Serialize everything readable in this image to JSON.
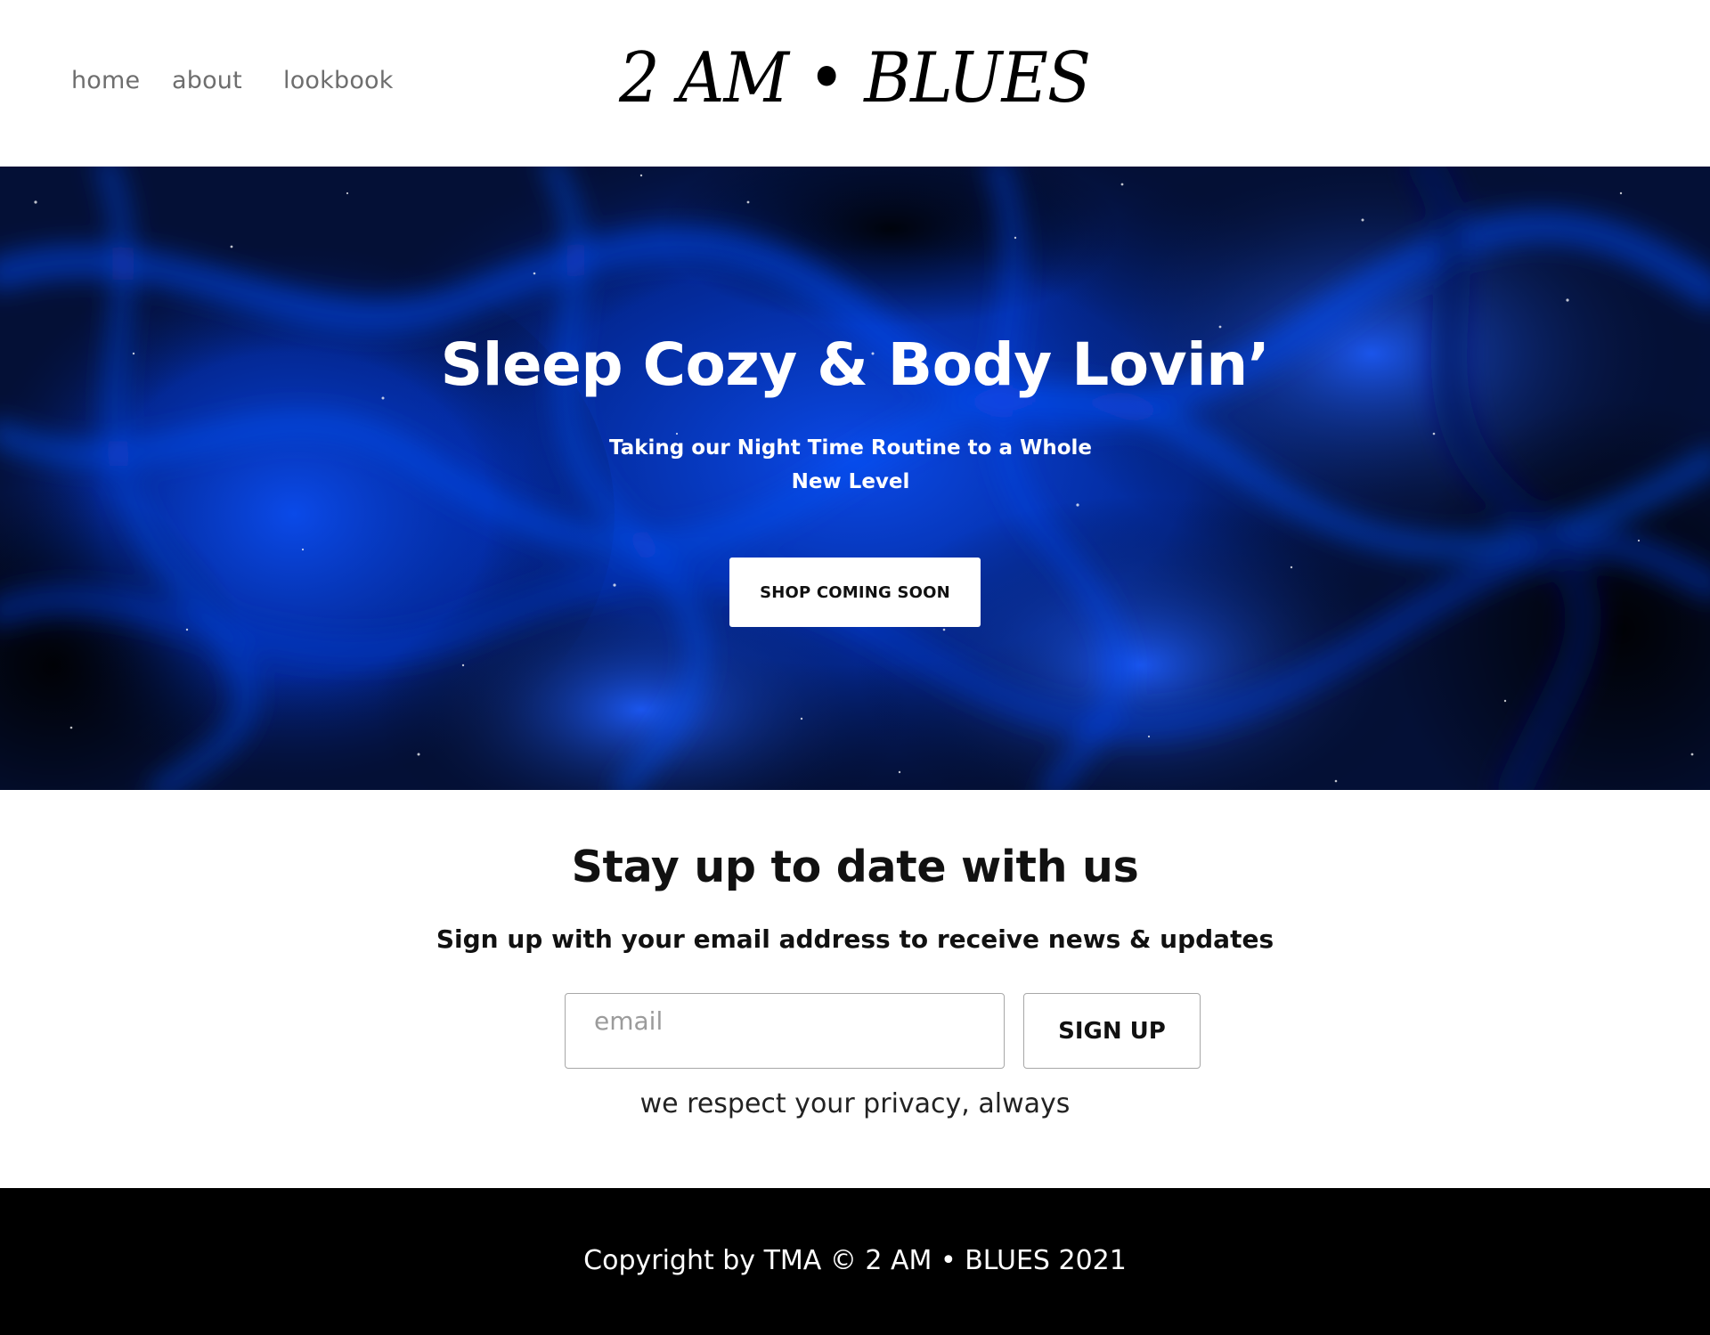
{
  "nav": {
    "home": "home",
    "about": "about",
    "lookbook": "lookbook"
  },
  "logo": {
    "text": "2 AM • BLUES"
  },
  "hero": {
    "title": "Sleep Cozy & Body Lovin’",
    "subtitle": "Taking our Night Time Routine to a Whole New Level",
    "button_label": "SHOP COMING SOON",
    "background_colors": [
      "#020616",
      "#0336c9",
      "#0b4df2",
      "#05195f"
    ]
  },
  "newsletter": {
    "title": "Stay up to date with us",
    "subtitle": "Sign up with your email address to receive news & updates",
    "email_placeholder": "email",
    "email_value": "",
    "button_label": "SIGN UP",
    "privacy_note": "we respect your privacy, always"
  },
  "footer": {
    "copyright": "Copyright by TMA © 2 AM • BLUES 2021"
  }
}
